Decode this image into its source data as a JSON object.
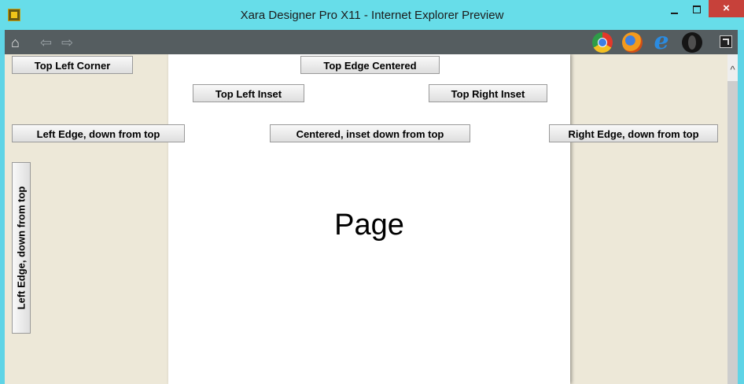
{
  "window": {
    "title": "Xara Designer Pro X11 - Internet Explorer Preview",
    "close_glyph": "×"
  },
  "toolbar": {
    "icons": [
      "home-icon",
      "back-icon",
      "forward-icon",
      "chrome-icon",
      "firefox-icon",
      "ie-icon",
      "opera-icon",
      "fullscreen-icon"
    ],
    "ie_glyph": "e"
  },
  "page": {
    "label": "Page"
  },
  "buttons": {
    "top_left_corner": "Top Left Corner",
    "top_edge_centered": "Top Edge Centered",
    "top_left_inset": "Top Left Inset",
    "top_right_inset": "Top Right Inset",
    "left_edge_down": "Left Edge, down from top",
    "centered_inset_down": "Centered, inset down from top",
    "right_edge_down": "Right Edge, down from top",
    "left_edge_vertical": "Left Edge, down from top"
  },
  "colors": {
    "titlebar": "#67dde9",
    "toolbar": "#555d60",
    "background": "#ede8d8",
    "page": "#ffffff",
    "close": "#c7413a"
  }
}
